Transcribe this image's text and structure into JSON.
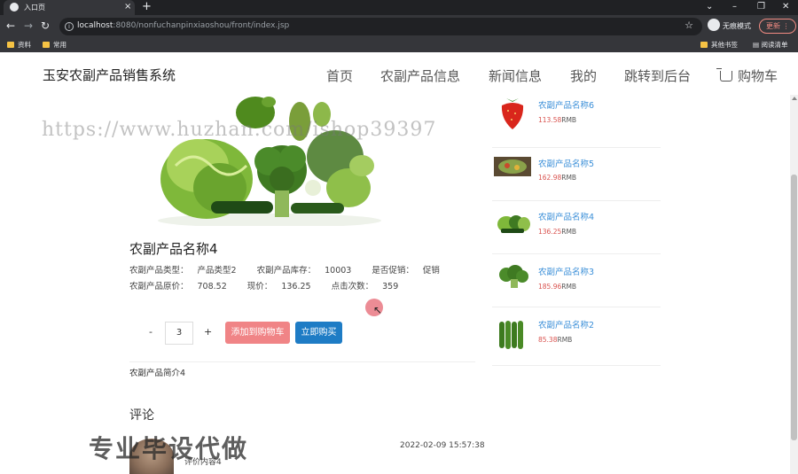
{
  "browser": {
    "tab_title": "入口页",
    "new_tab": "+",
    "tab_close": "×",
    "url_host": "localhost",
    "url_path": ":8080/nonfuchanpinxiaoshou/front/index.jsp",
    "incognito_label": "无痕模式",
    "update_label": "更新",
    "bookmarks": [
      "资料",
      "常用"
    ],
    "other_bookmarks": "其他书签",
    "reading_list": "阅读清单"
  },
  "site": {
    "brand": "玉安农副产品销售系统",
    "nav": [
      "首页",
      "农副产品信息",
      "新闻信息",
      "我的",
      "跳转到后台",
      "购物车"
    ]
  },
  "watermarks": {
    "url": "https://www.huzhan.com/ishop39397",
    "big": "专业毕设代做"
  },
  "product": {
    "title": "农副产品名称4",
    "type_label": "农副产品类型：",
    "type_value": "产品类型2",
    "stock_label": "农副产品库存：",
    "stock_value": "10003",
    "promo_label": "是否促销：",
    "promo_value": "促销",
    "orig_price_label": "农副产品原价：",
    "orig_price_value": "708.52",
    "price_label": "现价：",
    "price_value": "136.25",
    "clicks_label": "点击次数：",
    "clicks_value": "359",
    "qty_minus": "-",
    "qty_value": "3",
    "qty_plus": "+",
    "add_to_cart": "添加到购物车",
    "buy_now": "立即购买",
    "intro": "农副产品简介4"
  },
  "comments": {
    "title": "评论",
    "items": [
      {
        "date": "2022-02-09 15:57:38",
        "text": "评价内容4"
      }
    ]
  },
  "sidebar": [
    {
      "name": "农副产品名称6",
      "price": "113.58",
      "unit": "RMB",
      "icon": "strawberry"
    },
    {
      "name": "农副产品名称5",
      "price": "162.98",
      "unit": "RMB",
      "icon": "salad-plate"
    },
    {
      "name": "农副产品名称4",
      "price": "136.25",
      "unit": "RMB",
      "icon": "vegetables"
    },
    {
      "name": "农副产品名称3",
      "price": "185.96",
      "unit": "RMB",
      "icon": "broccoli"
    },
    {
      "name": "农副产品名称2",
      "price": "85.38",
      "unit": "RMB",
      "icon": "cucumbers"
    }
  ],
  "colors": {
    "add_button": "#f08486",
    "buy_button": "#1e7cc5",
    "link": "#3b8fd8",
    "price": "#d9534f"
  }
}
